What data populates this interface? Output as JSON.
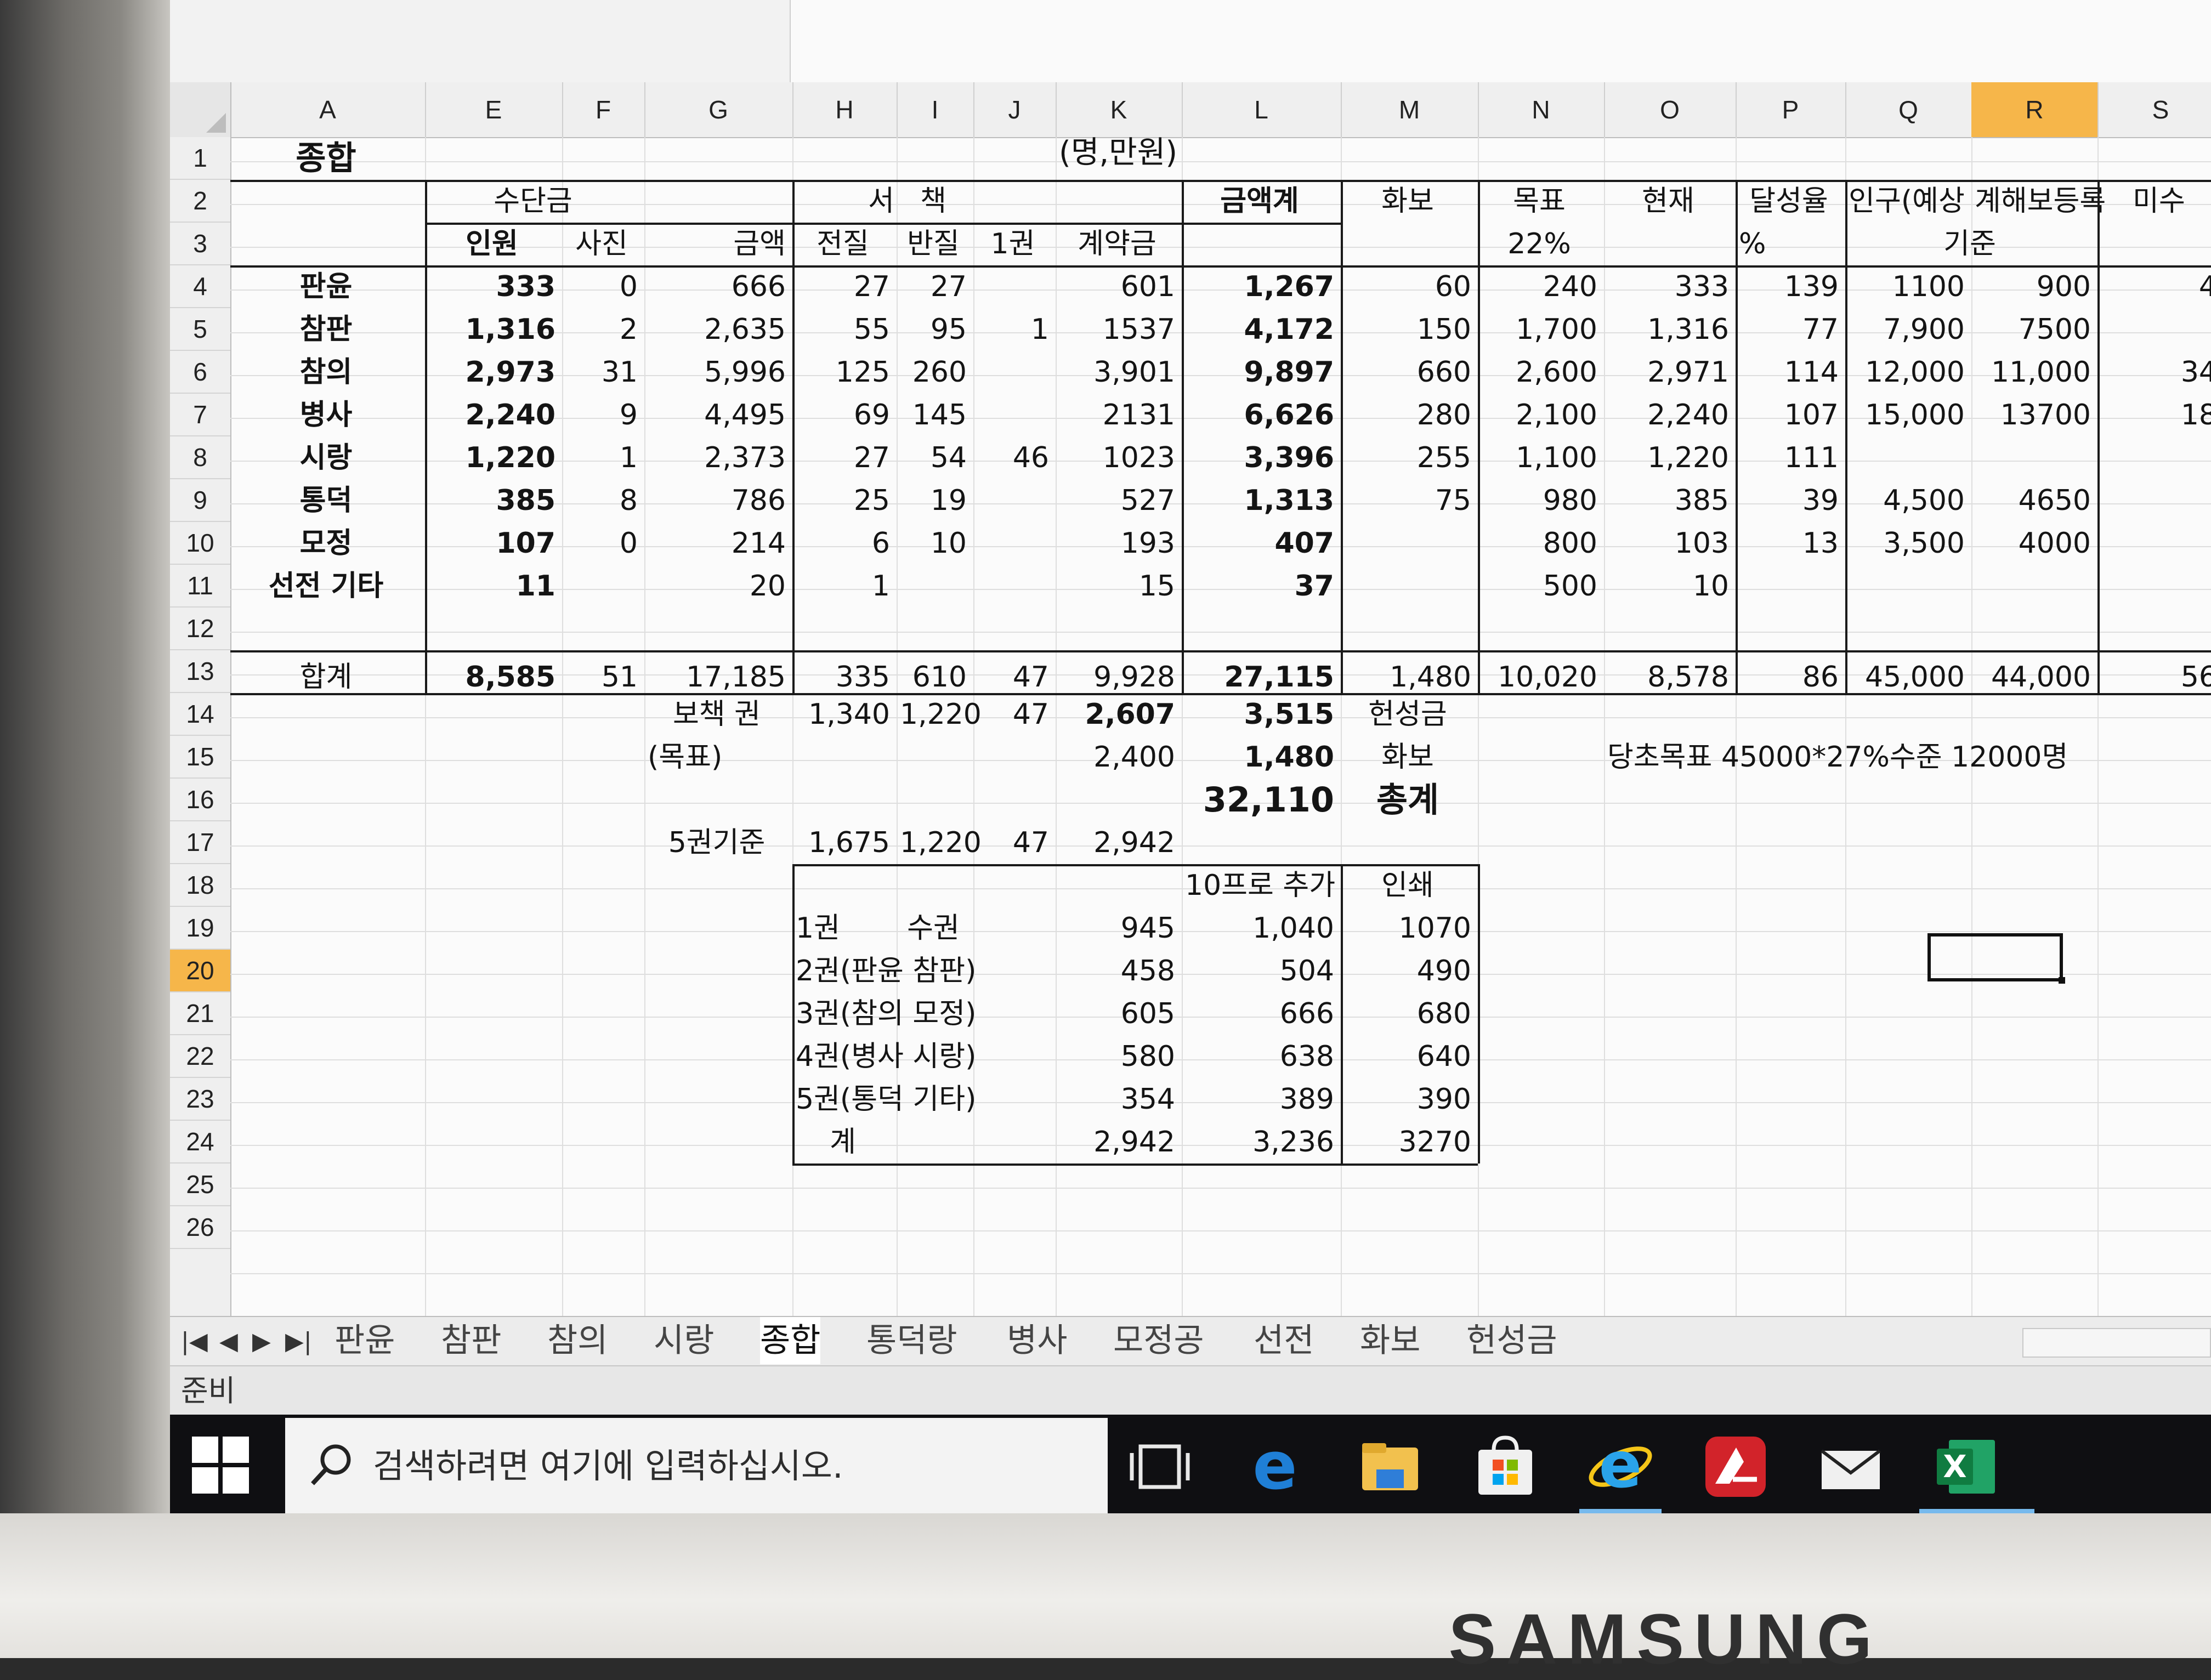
{
  "bezel": {
    "brand": "SAMSUNG"
  },
  "columns": [
    "A",
    "E",
    "F",
    "G",
    "H",
    "I",
    "J",
    "K",
    "L",
    "M",
    "N",
    "O",
    "P",
    "Q",
    "R",
    "S"
  ],
  "active_column": "R",
  "rows": [
    "1",
    "2",
    "3",
    "4",
    "5",
    "6",
    "7",
    "8",
    "9",
    "10",
    "11",
    "12",
    "13",
    "14",
    "15",
    "16",
    "17",
    "18",
    "19",
    "20",
    "21",
    "22",
    "23",
    "24",
    "25",
    "26"
  ],
  "active_row": "20",
  "sheet": {
    "title": "종합",
    "unit": "(명,만원)",
    "group_headers": {
      "sudangeum": "수단금",
      "seo": "서",
      "chaek": "책",
      "total": "금액계",
      "hwabo": "화보",
      "mokpyo": "목표",
      "hyeonjae": "현재",
      "dalseong": "달성율",
      "ingu": "인구(예상",
      "gyehae": "계해보등록",
      "misu": "미수"
    },
    "sub_headers": {
      "inwon": "인원",
      "sajin": "사진",
      "geumaek": "금액",
      "jeonjil": "전질",
      "banjil": "반질",
      "ilgwon": "1권",
      "gyeyakgeum": "계약금",
      "pct22": "22%",
      "pct": "%",
      "gijun": "기준"
    },
    "data_rows": [
      {
        "name": "판윤",
        "E": "333",
        "F": "0",
        "G": "666",
        "H": "27",
        "I": "27",
        "J": "",
        "K": "601",
        "L": "1,267",
        "M": "60",
        "N": "240",
        "O": "333",
        "P": "139",
        "Q": "1100",
        "R": "900",
        "S": "4"
      },
      {
        "name": "참판",
        "E": "1,316",
        "F": "2",
        "G": "2,635",
        "H": "55",
        "I": "95",
        "J": "1",
        "K": "1537",
        "L": "4,172",
        "M": "150",
        "N": "1,700",
        "O": "1,316",
        "P": "77",
        "Q": "7,900",
        "R": "7500",
        "S": ""
      },
      {
        "name": "참의",
        "E": "2,973",
        "F": "31",
        "G": "5,996",
        "H": "125",
        "I": "260",
        "J": "",
        "K": "3,901",
        "L": "9,897",
        "M": "660",
        "N": "2,600",
        "O": "2,971",
        "P": "114",
        "Q": "12,000",
        "R": "11,000",
        "S": "34"
      },
      {
        "name": "병사",
        "E": "2,240",
        "F": "9",
        "G": "4,495",
        "H": "69",
        "I": "145",
        "J": "",
        "K": "2131",
        "L": "6,626",
        "M": "280",
        "N": "2,100",
        "O": "2,240",
        "P": "107",
        "Q": "15,000",
        "R": "13700",
        "S": "18"
      },
      {
        "name": "시랑",
        "E": "1,220",
        "F": "1",
        "G": "2,373",
        "H": "27",
        "I": "54",
        "J": "46",
        "K": "1023",
        "L": "3,396",
        "M": "255",
        "N": "1,100",
        "O": "1,220",
        "P": "111",
        "Q": "",
        "R": "",
        "S": ""
      },
      {
        "name": "통덕",
        "E": "385",
        "F": "8",
        "G": "786",
        "H": "25",
        "I": "19",
        "J": "",
        "K": "527",
        "L": "1,313",
        "M": "75",
        "N": "980",
        "O": "385",
        "P": "39",
        "Q": "4,500",
        "R": "4650",
        "S": ""
      },
      {
        "name": "모정",
        "E": "107",
        "F": "0",
        "G": "214",
        "H": "6",
        "I": "10",
        "J": "",
        "K": "193",
        "L": "407",
        "M": "",
        "N": "800",
        "O": "103",
        "P": "13",
        "Q": "3,500",
        "R": "4000",
        "S": ""
      },
      {
        "name": "선전 기타",
        "E": "11",
        "F": "",
        "G": "20",
        "H": "1",
        "I": "",
        "J": "",
        "K": "15",
        "L": "37",
        "M": "",
        "N": "500",
        "O": "10",
        "P": "",
        "Q": "",
        "R": "",
        "S": ""
      }
    ],
    "total_row": {
      "name": "합계",
      "E": "8,585",
      "F": "51",
      "G": "17,185",
      "H": "335",
      "I": "610",
      "J": "47",
      "K": "9,928",
      "L": "27,115",
      "M": "1,480",
      "N": "10,020",
      "O": "8,578",
      "P": "86",
      "Q": "45,000",
      "R": "44,000",
      "S": "56"
    },
    "row14": {
      "label": "보책 권",
      "H": "1,340",
      "I": "1,220",
      "J": "47",
      "K": "2,607",
      "L": "3,515",
      "M": "헌성금"
    },
    "row15": {
      "label": "(목표)",
      "K": "2,400",
      "L": "1,480",
      "M": "화보",
      "note": "당초목표 45000*27%수준 12000명"
    },
    "row16": {
      "L": "32,110",
      "M": "총계"
    },
    "row17": {
      "label": "5권기준",
      "H": "1,675",
      "I": "1,220",
      "J": "47",
      "K": "2,942"
    },
    "sub_table": {
      "headers": {
        "L": "10프로 추가",
        "M": "인쇄"
      },
      "rows": [
        {
          "name": "1권",
          "name2": "수권",
          "K": "945",
          "L": "1,040",
          "M": "1070"
        },
        {
          "name": "2권(판윤 참판)",
          "name2": "",
          "K": "458",
          "L": "504",
          "M": "490"
        },
        {
          "name": "3권(참의 모정)",
          "name2": "",
          "K": "605",
          "L": "666",
          "M": "680"
        },
        {
          "name": "4권(병사 시랑)",
          "name2": "",
          "K": "580",
          "L": "638",
          "M": "640"
        },
        {
          "name": "5권(통덕 기타)",
          "name2": "",
          "K": "354",
          "L": "389",
          "M": "390"
        },
        {
          "name": "계",
          "name2": "",
          "K": "2,942",
          "L": "3,236",
          "M": "3270"
        }
      ]
    }
  },
  "tabs": [
    "판윤",
    "참판",
    "참의",
    "시랑",
    "종합",
    "통덕랑",
    "병사",
    "모정공",
    "선전",
    "화보",
    "헌성금"
  ],
  "active_tab": "종합",
  "status": "준비",
  "taskbar": {
    "search_placeholder": "검색하려면 여기에 입력하십시오.",
    "icons": [
      "windows-start-icon",
      "task-view-icon",
      "edge-icon",
      "file-explorer-icon",
      "store-icon",
      "internet-explorer-icon",
      "adobe-reader-icon",
      "mail-icon",
      "excel-icon"
    ]
  },
  "colors": {
    "accent_header": "#f6b64a",
    "taskbar": "#0f0f12",
    "underline": "#76b9ed"
  }
}
